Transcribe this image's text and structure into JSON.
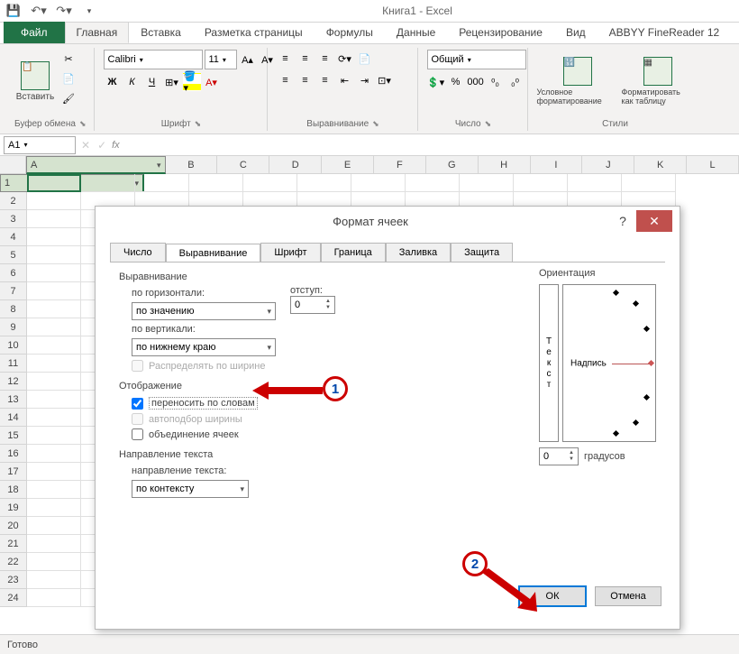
{
  "app": {
    "title": "Книга1 - Excel"
  },
  "qat": {
    "save": "💾",
    "undo": "↶",
    "redo": "↷"
  },
  "tabs": [
    "Файл",
    "Главная",
    "Вставка",
    "Разметка страницы",
    "Формулы",
    "Данные",
    "Рецензирование",
    "Вид",
    "ABBYY FineReader 12"
  ],
  "ribbon": {
    "clipboard": {
      "label": "Буфер обмена",
      "paste": "Вставить"
    },
    "font": {
      "label": "Шрифт",
      "name": "Calibri",
      "size": "11",
      "bold": "Ж",
      "italic": "К",
      "underline": "Ч"
    },
    "align": {
      "label": "Выравнивание"
    },
    "number": {
      "label": "Число",
      "format": "Общий"
    },
    "styles": {
      "label": "Стили",
      "cond": "Условное форматирование",
      "table": "Форматировать как таблицу"
    }
  },
  "namebox": "A1",
  "cols": [
    "A",
    "B",
    "C",
    "D",
    "E",
    "F",
    "G",
    "H",
    "I",
    "J",
    "K",
    "L"
  ],
  "status": "Готово",
  "dialog": {
    "title": "Формат ячеек",
    "tabs": [
      "Число",
      "Выравнивание",
      "Шрифт",
      "Граница",
      "Заливка",
      "Защита"
    ],
    "align_sect": "Выравнивание",
    "horiz_lbl": "по горизонтали:",
    "horiz_val": "по значению",
    "indent_lbl": "отступ:",
    "indent_val": "0",
    "vert_lbl": "по вертикали:",
    "vert_val": "по нижнему краю",
    "distribute": "Распределять по ширине",
    "display_sect": "Отображение",
    "wrap": "переносить по словам",
    "autofit": "автоподбор ширины",
    "merge": "объединение ячеек",
    "dir_sect": "Направление текста",
    "dir_lbl": "направление текста:",
    "dir_val": "по контексту",
    "orient_sect": "Ориентация",
    "orient_vert": "Текст",
    "orient_label": "Надпись",
    "deg_val": "0",
    "deg_lbl": "градусов",
    "ok": "ОК",
    "cancel": "Отмена"
  },
  "annot": {
    "n1": "1",
    "n2": "2"
  }
}
